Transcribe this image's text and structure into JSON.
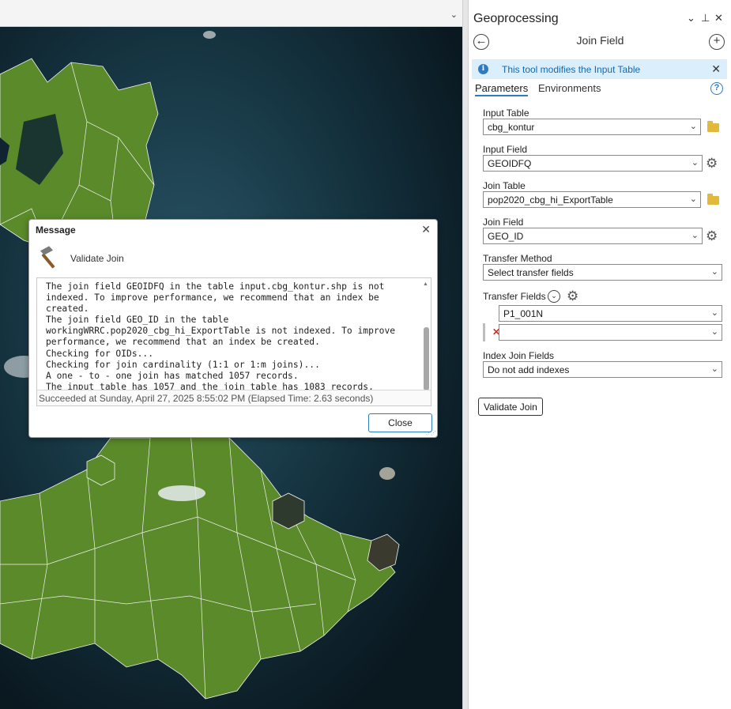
{
  "map": {
    "toolbar_chevron": "⌄"
  },
  "pane": {
    "title": "Geoprocessing",
    "controls": {
      "dropdown": "⌄",
      "pin": "⊥",
      "close": "✕"
    },
    "tool_name": "Join Field",
    "back_icon": "arrow-left-icon",
    "add_icon": "plus-circle-icon",
    "info": {
      "text": "This tool modifies the Input Table",
      "icon": "info-icon",
      "close": "✕"
    },
    "tabs": [
      {
        "label": "Parameters",
        "active": true
      },
      {
        "label": "Environments",
        "active": false
      }
    ],
    "help": "?",
    "params": {
      "input_table": {
        "label": "Input Table",
        "value": "cbg_kontur"
      },
      "input_field": {
        "label": "Input Field",
        "value": "GEOIDFQ"
      },
      "join_table": {
        "label": "Join Table",
        "value": "pop2020_cbg_hi_ExportTable"
      },
      "join_field": {
        "label": "Join Field",
        "value": "GEO_ID"
      },
      "transfer_method": {
        "label": "Transfer Method",
        "value": "Select transfer fields"
      },
      "transfer_fields": {
        "label": "Transfer Fields",
        "values": [
          "P1_001N",
          ""
        ]
      },
      "index_join_fields": {
        "label": "Index Join Fields",
        "value": "Do not add indexes"
      }
    },
    "validate_button": "Validate Join",
    "arrow": "⌄",
    "gear": "⚙",
    "remove": "✕",
    "toggle": "⌄"
  },
  "dialog": {
    "title": "Message",
    "close": "✕",
    "heading": "Validate Join",
    "message_lines": [
      "The join field GEOIDFQ in the table input.cbg_kontur.shp is not",
      "indexed. To improve performance, we recommend that an index be",
      "created.",
      "The join field GEO_ID in the table",
      "workingWRRC.pop2020_cbg_hi_ExportTable is not indexed. To improve",
      "performance, we recommend that an index be created.",
      "Checking for OIDs...",
      "Checking for join cardinality (1:1 or 1:m joins)...",
      "A one - to - one join has matched 1057 records.",
      "The input table has 1057 and the join table has 1083 records."
    ],
    "status": "Succeeded at Sunday, April 27, 2025 8:55:02 PM (Elapsed Time: 2.63 seconds)",
    "close_button": "Close",
    "colors": {
      "accent": "#2d7bc4",
      "land": "#5a8a2a",
      "water": "#0f2430"
    }
  }
}
